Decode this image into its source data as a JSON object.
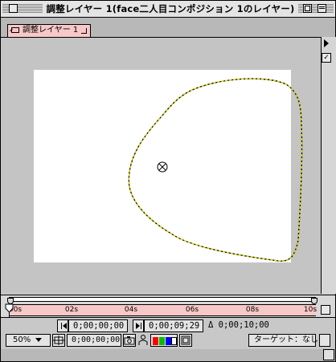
{
  "window": {
    "title": "調整レイヤー 1(face二人目コンポジション 1のレイヤー)"
  },
  "tab": {
    "label": "調整レイヤー 1"
  },
  "timeline": {
    "ticks": [
      "00s",
      "02s",
      "04s",
      "06s",
      "08s",
      "10s"
    ]
  },
  "timecodes": {
    "current_label": "0;00;00;00",
    "out_label": "0;00;09;29",
    "duration_prefix": "Δ",
    "duration_label": "0;00;10;00"
  },
  "bottom": {
    "zoom": "50%",
    "snapshot_time": "0;00;00;00",
    "target_label": "ターゲット：なし",
    "channel_colors": [
      "#ff0000",
      "#00c000",
      "#0000ff",
      "#ffffff"
    ]
  },
  "icons": {
    "in_point": "in-point-icon",
    "out_point": "out-point-icon",
    "anchor": "anchor-point-icon",
    "camera": "camera-icon",
    "show_snapshot": "person-icon",
    "region": "region-of-interest-icon",
    "grid": "safe-zones-icon"
  },
  "colors": {
    "tab_pink": "#f8c8c8",
    "mask_yellow": "#e8e000"
  }
}
